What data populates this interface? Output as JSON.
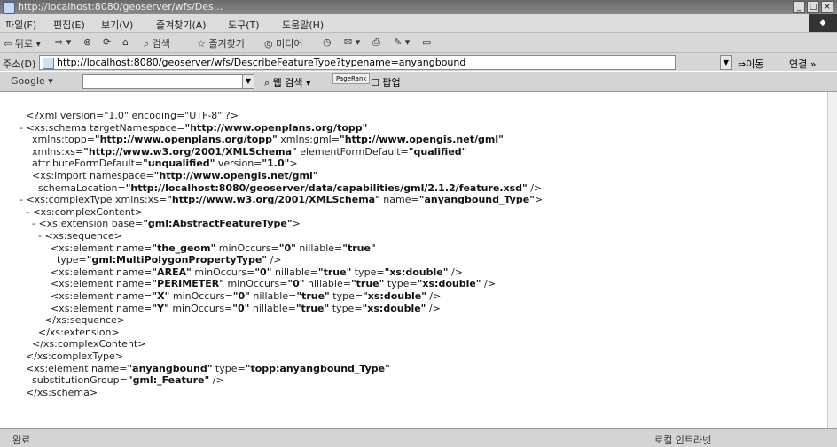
{
  "window": {
    "title": "http://localhost:8080/geoserver/wfs/Des..."
  },
  "menu": [
    "파일(F)",
    "편집(E)",
    "보기(V)",
    "즐겨찾기(A)",
    "도구(T)",
    "도움말(H)"
  ],
  "toolbar": {
    "back_label": "뒤로",
    "search_label": "검색",
    "favorites_label": "즐겨찾기",
    "media_label": "미디어"
  },
  "address_bar": {
    "label": "주소(D)",
    "url": "http://localhost:8080/geoserver/wfs/DescribeFeatureType?typename=anyangbound",
    "go_label": "이동",
    "links_label": "연결 »"
  },
  "google_bar": {
    "logo": "Google",
    "search_button": "웹 검색",
    "pagerank_label": "PageRank",
    "popup_label": "팝업"
  },
  "xml_lines": [
    {
      "prefix": "  ",
      "segs": [
        [
          "<?xml version=\"1.0\" encoding=\"UTF-8\" ?>",
          false
        ]
      ]
    },
    {
      "prefix": "- ",
      "segs": [
        [
          "<xs:schema targetNamespace=",
          false
        ],
        [
          "\"http://www.openplans.org/topp\"",
          true
        ]
      ]
    },
    {
      "prefix": "    ",
      "segs": [
        [
          "xmlns:topp=",
          false
        ],
        [
          "\"http://www.openplans.org/topp\"",
          true
        ],
        [
          " xmlns:gml=",
          false
        ],
        [
          "\"http://www.opengis.net/gml\"",
          true
        ]
      ]
    },
    {
      "prefix": "    ",
      "segs": [
        [
          "xmlns:xs=",
          false
        ],
        [
          "\"http://www.w3.org/2001/XMLSchema\"",
          true
        ],
        [
          " elementFormDefault=",
          false
        ],
        [
          "\"qualified\"",
          true
        ]
      ]
    },
    {
      "prefix": "    ",
      "segs": [
        [
          "attributeFormDefault=",
          false
        ],
        [
          "\"unqualified\"",
          true
        ],
        [
          " version=",
          false
        ],
        [
          "\"1.0\"",
          true
        ],
        [
          ">",
          false
        ]
      ]
    },
    {
      "prefix": "    ",
      "segs": [
        [
          "<xs:import namespace=",
          false
        ],
        [
          "\"http://www.opengis.net/gml\"",
          true
        ]
      ]
    },
    {
      "prefix": "      ",
      "segs": [
        [
          "schemaLocation=",
          false
        ],
        [
          "\"http://localhost:8080/geoserver/data/capabilities/gml/2.1.2/feature.xsd\"",
          true
        ],
        [
          " />",
          false
        ]
      ]
    },
    {
      "prefix": "- ",
      "segs": [
        [
          "<xs:complexType xmlns:xs=",
          false
        ],
        [
          "\"http://www.w3.org/2001/XMLSchema\"",
          true
        ],
        [
          " name=",
          false
        ],
        [
          "\"anyangbound_Type\"",
          true
        ],
        [
          ">",
          false
        ]
      ]
    },
    {
      "prefix": "  - ",
      "segs": [
        [
          "<xs:complexContent>",
          false
        ]
      ]
    },
    {
      "prefix": "    - ",
      "segs": [
        [
          "<xs:extension base=",
          false
        ],
        [
          "\"gml:AbstractFeatureType\"",
          true
        ],
        [
          ">",
          false
        ]
      ]
    },
    {
      "prefix": "      - ",
      "segs": [
        [
          "<xs:sequence>",
          false
        ]
      ]
    },
    {
      "prefix": "          ",
      "segs": [
        [
          "<xs:element name=",
          false
        ],
        [
          "\"the_geom\"",
          true
        ],
        [
          " minOccurs=",
          false
        ],
        [
          "\"0\"",
          true
        ],
        [
          " nillable=",
          false
        ],
        [
          "\"true\"",
          true
        ]
      ]
    },
    {
      "prefix": "            ",
      "segs": [
        [
          "type=",
          false
        ],
        [
          "\"gml:MultiPolygonPropertyType\"",
          true
        ],
        [
          " />",
          false
        ]
      ]
    },
    {
      "prefix": "          ",
      "segs": [
        [
          "<xs:element name=",
          false
        ],
        [
          "\"AREA\"",
          true
        ],
        [
          " minOccurs=",
          false
        ],
        [
          "\"0\"",
          true
        ],
        [
          " nillable=",
          false
        ],
        [
          "\"true\"",
          true
        ],
        [
          " type=",
          false
        ],
        [
          "\"xs:double\"",
          true
        ],
        [
          " />",
          false
        ]
      ]
    },
    {
      "prefix": "          ",
      "segs": [
        [
          "<xs:element name=",
          false
        ],
        [
          "\"PERIMETER\"",
          true
        ],
        [
          " minOccurs=",
          false
        ],
        [
          "\"0\"",
          true
        ],
        [
          " nillable=",
          false
        ],
        [
          "\"true\"",
          true
        ],
        [
          " type=",
          false
        ],
        [
          "\"xs:double\"",
          true
        ],
        [
          " />",
          false
        ]
      ]
    },
    {
      "prefix": "          ",
      "segs": [
        [
          "<xs:element name=",
          false
        ],
        [
          "\"X\"",
          true
        ],
        [
          " minOccurs=",
          false
        ],
        [
          "\"0\"",
          true
        ],
        [
          " nillable=",
          false
        ],
        [
          "\"true\"",
          true
        ],
        [
          " type=",
          false
        ],
        [
          "\"xs:double\"",
          true
        ],
        [
          " />",
          false
        ]
      ]
    },
    {
      "prefix": "          ",
      "segs": [
        [
          "<xs:element name=",
          false
        ],
        [
          "\"Y\"",
          true
        ],
        [
          " minOccurs=",
          false
        ],
        [
          "\"0\"",
          true
        ],
        [
          " nillable=",
          false
        ],
        [
          "\"true\"",
          true
        ],
        [
          " type=",
          false
        ],
        [
          "\"xs:double\"",
          true
        ],
        [
          " />",
          false
        ]
      ]
    },
    {
      "prefix": "        ",
      "segs": [
        [
          "</xs:sequence>",
          false
        ]
      ]
    },
    {
      "prefix": "      ",
      "segs": [
        [
          "</xs:extension>",
          false
        ]
      ]
    },
    {
      "prefix": "    ",
      "segs": [
        [
          "</xs:complexContent>",
          false
        ]
      ]
    },
    {
      "prefix": "  ",
      "segs": [
        [
          "</xs:complexType>",
          false
        ]
      ]
    },
    {
      "prefix": "  ",
      "segs": [
        [
          "<xs:element name=",
          false
        ],
        [
          "\"anyangbound\"",
          true
        ],
        [
          " type=",
          false
        ],
        [
          "\"topp:anyangbound_Type\"",
          true
        ]
      ]
    },
    {
      "prefix": "    ",
      "segs": [
        [
          "substitutionGroup=",
          false
        ],
        [
          "\"gml:_Feature\"",
          true
        ],
        [
          " />",
          false
        ]
      ]
    },
    {
      "prefix": "  ",
      "segs": [
        [
          "</xs:schema>",
          false
        ]
      ]
    }
  ],
  "status": {
    "text": "완료",
    "zone": "로컬 인트라넷"
  }
}
